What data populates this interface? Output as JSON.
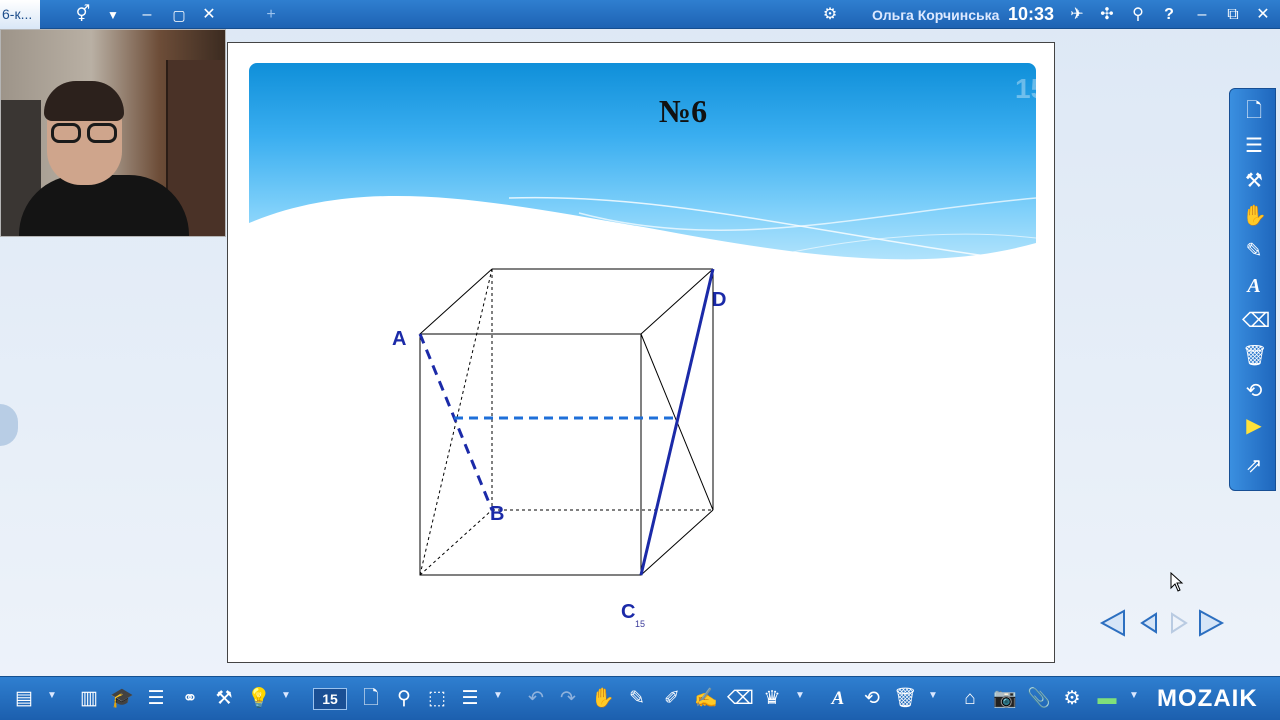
{
  "topbar": {
    "tab_label": "6-к...",
    "user_name": "Ольга Корчинська",
    "time": "10:33",
    "icons": [
      "gender-icon",
      "dropdown-icon",
      "minimize-icon",
      "maximize-icon",
      "close-icon",
      "new-tab-icon",
      "settings-icon",
      "rocket-icon",
      "apps-icon",
      "search-icon",
      "help-icon",
      "window-minimize-icon",
      "window-restore-icon",
      "window-close-icon"
    ]
  },
  "slide": {
    "title": "№6",
    "page_number_watermark": "15",
    "footer_page": "15",
    "labels": {
      "a": "A",
      "b": "B",
      "c": "C",
      "d": "D"
    },
    "colors": {
      "header_top": "#0f8fd9",
      "header_bottom": "#bfe8fc",
      "label": "#1b2aa8",
      "highlight_line": "#1b2aa8",
      "dashed_mid": "#1e6fd9"
    }
  },
  "right_toolbar": {
    "tools": [
      "new-page-icon",
      "notes-icon",
      "hammer-icon",
      "hand-icon",
      "pen-icon",
      "text-icon",
      "eraser-icon",
      "trash-icon",
      "undo-icon",
      "play-icon",
      "export-icon"
    ]
  },
  "bottom_toolbar": {
    "page_field": "15",
    "logo": "MOZAIK"
  }
}
